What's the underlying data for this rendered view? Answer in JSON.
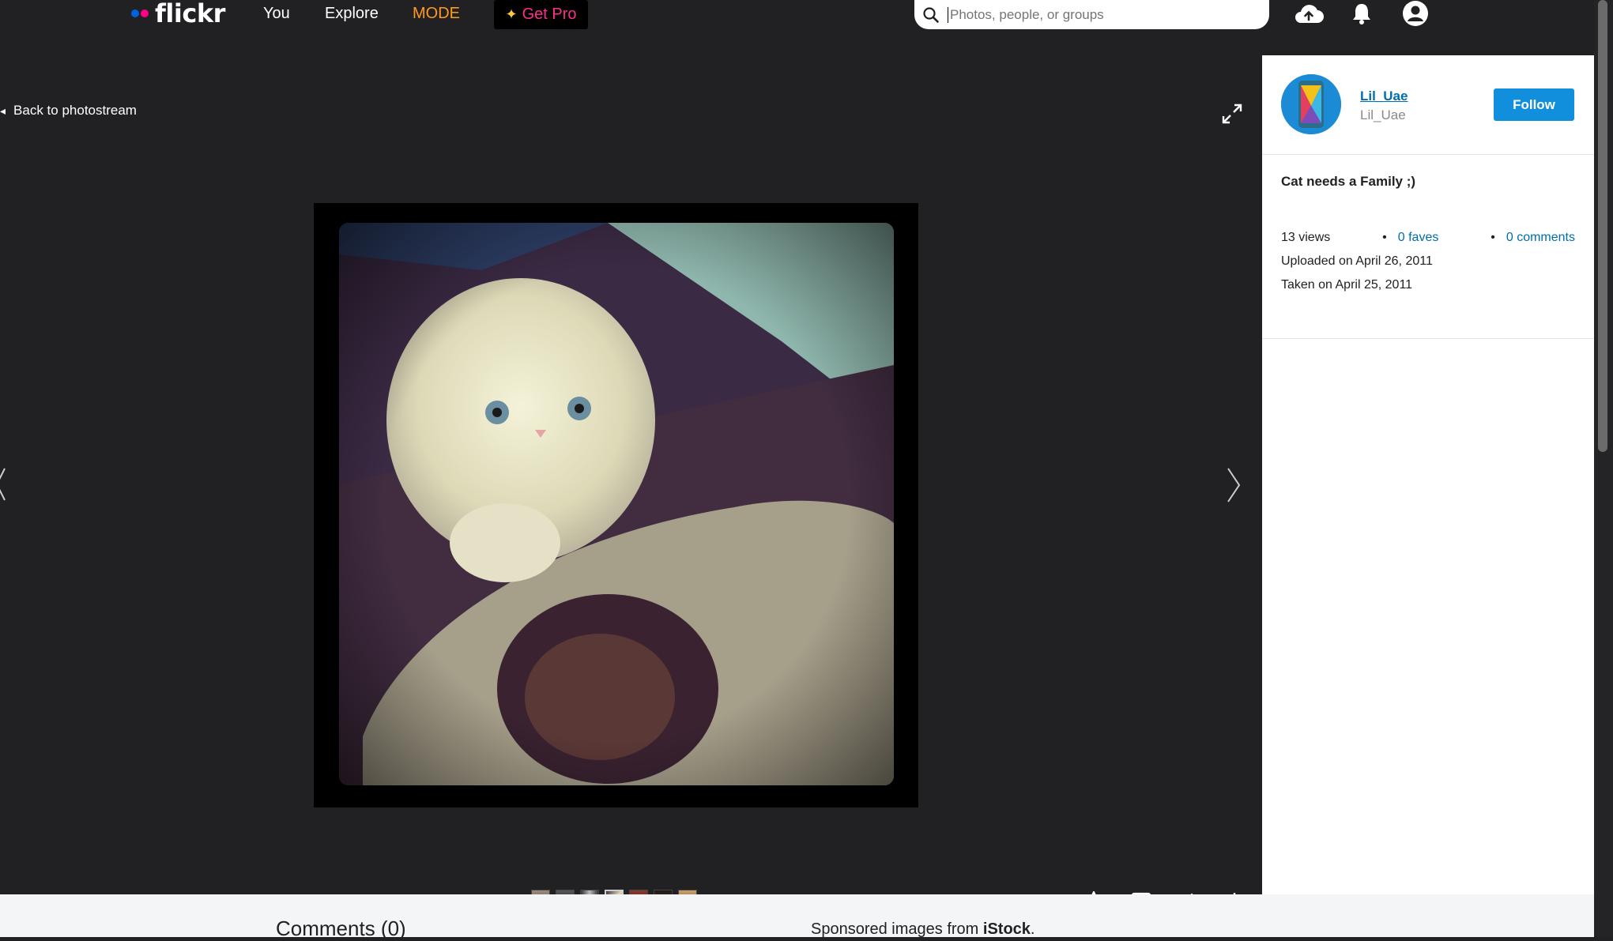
{
  "header": {
    "logo_text": "flickr",
    "nav_you": "You",
    "nav_explore": "Explore",
    "nav_mode": "MODE",
    "get_pro": "Get Pro",
    "search_placeholder": "Photos, people, or groups"
  },
  "viewer": {
    "back_label": "Back to photostream",
    "thumbnails": [
      "thumb-1",
      "thumb-2",
      "thumb-3",
      "thumb-4",
      "thumb-5",
      "thumb-6",
      "thumb-7"
    ],
    "active_thumbnail": 4
  },
  "sidebar": {
    "owner_name": "Lil_Uae",
    "owner_subtitle": "Lil_Uae",
    "follow_label": "Follow",
    "photo_title": "Cat needs a Family ;)",
    "views": "13 views",
    "faves": "0 faves",
    "comments": "0 comments",
    "uploaded": "Uploaded on April 26, 2011",
    "taken": "Taken on April 25, 2011"
  },
  "bottom": {
    "comments_heading": "Comments (0)",
    "sponsored_prefix": "Sponsored images from",
    "sponsored_brand": "iStock"
  },
  "colors": {
    "accent_blue": "#128fdc",
    "link_blue": "#006dac",
    "mode_orange": "#ff9a1f",
    "pro_pink": "#ff2d8a",
    "flickr_blue": "#0063dc",
    "flickr_pink": "#ff0084"
  }
}
